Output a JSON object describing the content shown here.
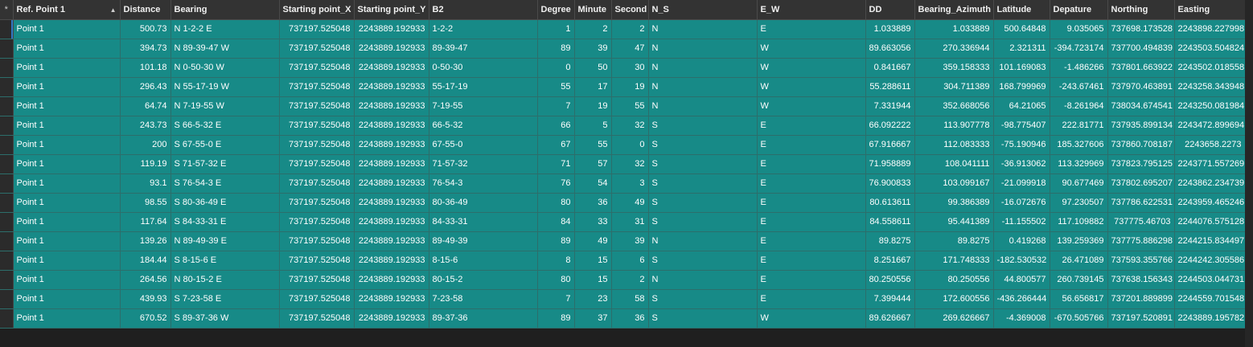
{
  "corner_symbol": "*",
  "sort_icon": "▲",
  "columns": [
    {
      "key": "ref",
      "label": "Ref. Point 1",
      "align": "txt"
    },
    {
      "key": "distance",
      "label": "Distance",
      "align": "num"
    },
    {
      "key": "bearing",
      "label": "Bearing",
      "align": "txt"
    },
    {
      "key": "sx",
      "label": "Starting point_X",
      "align": "num"
    },
    {
      "key": "sy",
      "label": "Starting point_Y",
      "align": "num"
    },
    {
      "key": "b2",
      "label": "B2",
      "align": "txt"
    },
    {
      "key": "degree",
      "label": "Degree",
      "align": "num"
    },
    {
      "key": "minute",
      "label": "Minute",
      "align": "num"
    },
    {
      "key": "second",
      "label": "Second",
      "align": "num"
    },
    {
      "key": "ns",
      "label": "N_S",
      "align": "txt"
    },
    {
      "key": "ew",
      "label": "E_W",
      "align": "txt"
    },
    {
      "key": "dd",
      "label": "DD",
      "align": "num"
    },
    {
      "key": "az",
      "label": "Bearing_Azimuth",
      "align": "num"
    },
    {
      "key": "lat",
      "label": "Latitude",
      "align": "num"
    },
    {
      "key": "dep",
      "label": "Depature",
      "align": "num"
    },
    {
      "key": "northing",
      "label": "Northing",
      "align": "num"
    },
    {
      "key": "easting",
      "label": "Easting",
      "align": "num"
    }
  ],
  "rows": [
    [
      "Point 1",
      "500.73",
      "N 1-2-2 E",
      "737197.525048",
      "2243889.192933",
      "1-2-2",
      "1",
      "2",
      "2",
      "N",
      "E",
      "1.033889",
      "1.033889",
      "500.64848",
      "9.035065",
      "737698.173528",
      "2243898.227998"
    ],
    [
      "Point 1",
      "394.73",
      "N 89-39-47 W",
      "737197.525048",
      "2243889.192933",
      "89-39-47",
      "89",
      "39",
      "47",
      "N",
      "W",
      "89.663056",
      "270.336944",
      "2.321311",
      "-394.723174",
      "737700.494839",
      "2243503.504824"
    ],
    [
      "Point 1",
      "101.18",
      "N 0-50-30 W",
      "737197.525048",
      "2243889.192933",
      "0-50-30",
      "0",
      "50",
      "30",
      "N",
      "W",
      "0.841667",
      "359.158333",
      "101.169083",
      "-1.486266",
      "737801.663922",
      "2243502.018558"
    ],
    [
      "Point 1",
      "296.43",
      "N 55-17-19 W",
      "737197.525048",
      "2243889.192933",
      "55-17-19",
      "55",
      "17",
      "19",
      "N",
      "W",
      "55.288611",
      "304.711389",
      "168.799969",
      "-243.67461",
      "737970.463891",
      "2243258.343948"
    ],
    [
      "Point 1",
      "64.74",
      "N 7-19-55 W",
      "737197.525048",
      "2243889.192933",
      "7-19-55",
      "7",
      "19",
      "55",
      "N",
      "W",
      "7.331944",
      "352.668056",
      "64.21065",
      "-8.261964",
      "738034.674541",
      "2243250.081984"
    ],
    [
      "Point 1",
      "243.73",
      "S 66-5-32 E",
      "737197.525048",
      "2243889.192933",
      "66-5-32",
      "66",
      "5",
      "32",
      "S",
      "E",
      "66.092222",
      "113.907778",
      "-98.775407",
      "222.81771",
      "737935.899134",
      "2243472.899694"
    ],
    [
      "Point 1",
      "200",
      "S 67-55-0 E",
      "737197.525048",
      "2243889.192933",
      "67-55-0",
      "67",
      "55",
      "0",
      "S",
      "E",
      "67.916667",
      "112.083333",
      "-75.190946",
      "185.327606",
      "737860.708187",
      "2243658.2273"
    ],
    [
      "Point 1",
      "119.19",
      "S 71-57-32 E",
      "737197.525048",
      "2243889.192933",
      "71-57-32",
      "71",
      "57",
      "32",
      "S",
      "E",
      "71.958889",
      "108.041111",
      "-36.913062",
      "113.329969",
      "737823.795125",
      "2243771.557269"
    ],
    [
      "Point 1",
      "93.1",
      "S 76-54-3 E",
      "737197.525048",
      "2243889.192933",
      "76-54-3",
      "76",
      "54",
      "3",
      "S",
      "E",
      "76.900833",
      "103.099167",
      "-21.099918",
      "90.677469",
      "737802.695207",
      "2243862.234739"
    ],
    [
      "Point 1",
      "98.55",
      "S 80-36-49 E",
      "737197.525048",
      "2243889.192933",
      "80-36-49",
      "80",
      "36",
      "49",
      "S",
      "E",
      "80.613611",
      "99.386389",
      "-16.072676",
      "97.230507",
      "737786.622531",
      "2243959.465246"
    ],
    [
      "Point 1",
      "117.64",
      "S 84-33-31 E",
      "737197.525048",
      "2243889.192933",
      "84-33-31",
      "84",
      "33",
      "31",
      "S",
      "E",
      "84.558611",
      "95.441389",
      "-11.155502",
      "117.109882",
      "737775.46703",
      "2244076.575128"
    ],
    [
      "Point 1",
      "139.26",
      "N 89-49-39 E",
      "737197.525048",
      "2243889.192933",
      "89-49-39",
      "89",
      "49",
      "39",
      "N",
      "E",
      "89.8275",
      "89.8275",
      "0.419268",
      "139.259369",
      "737775.886298",
      "2244215.834497"
    ],
    [
      "Point 1",
      "184.44",
      "S 8-15-6 E",
      "737197.525048",
      "2243889.192933",
      "8-15-6",
      "8",
      "15",
      "6",
      "S",
      "E",
      "8.251667",
      "171.748333",
      "-182.530532",
      "26.471089",
      "737593.355766",
      "2244242.305586"
    ],
    [
      "Point 1",
      "264.56",
      "N 80-15-2 E",
      "737197.525048",
      "2243889.192933",
      "80-15-2",
      "80",
      "15",
      "2",
      "N",
      "E",
      "80.250556",
      "80.250556",
      "44.800577",
      "260.739145",
      "737638.156343",
      "2244503.044731"
    ],
    [
      "Point 1",
      "439.93",
      "S 7-23-58 E",
      "737197.525048",
      "2243889.192933",
      "7-23-58",
      "7",
      "23",
      "58",
      "S",
      "E",
      "7.399444",
      "172.600556",
      "-436.266444",
      "56.656817",
      "737201.889899",
      "2244559.701548"
    ],
    [
      "Point 1",
      "670.52",
      "S 89-37-36 W",
      "737197.525048",
      "2243889.192933",
      "89-37-36",
      "89",
      "37",
      "36",
      "S",
      "W",
      "89.626667",
      "269.626667",
      "-4.369008",
      "-670.505766",
      "737197.520891",
      "2243889.195782"
    ]
  ]
}
